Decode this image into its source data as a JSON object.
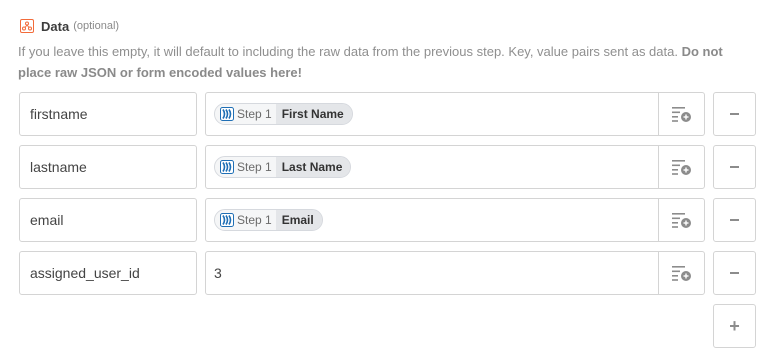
{
  "field": {
    "title": "Data",
    "optional": "(optional)",
    "help_text": "If you leave this empty, it will default to including the raw data from the previous step. Key, value pairs sent as data.",
    "help_strong": "Do not place raw JSON or form encoded values here!"
  },
  "rows": [
    {
      "key": "firstname",
      "pill": {
        "step": "Step 1",
        "label": "First Name"
      }
    },
    {
      "key": "lastname",
      "pill": {
        "step": "Step 1",
        "label": "Last Name"
      }
    },
    {
      "key": "email",
      "pill": {
        "step": "Step 1",
        "label": "Email"
      }
    },
    {
      "key": "assigned_user_id",
      "value": "3"
    }
  ],
  "add_label": "+",
  "colors": {
    "accent": "#f26b3a",
    "app_blue": "#1f6fb5",
    "border": "#d4d4d4"
  },
  "icons": {
    "field": "webhook-icon",
    "insert": "insert-field-icon",
    "remove": "minus-icon",
    "add": "plus-icon",
    "app": "app-logo-icon"
  }
}
